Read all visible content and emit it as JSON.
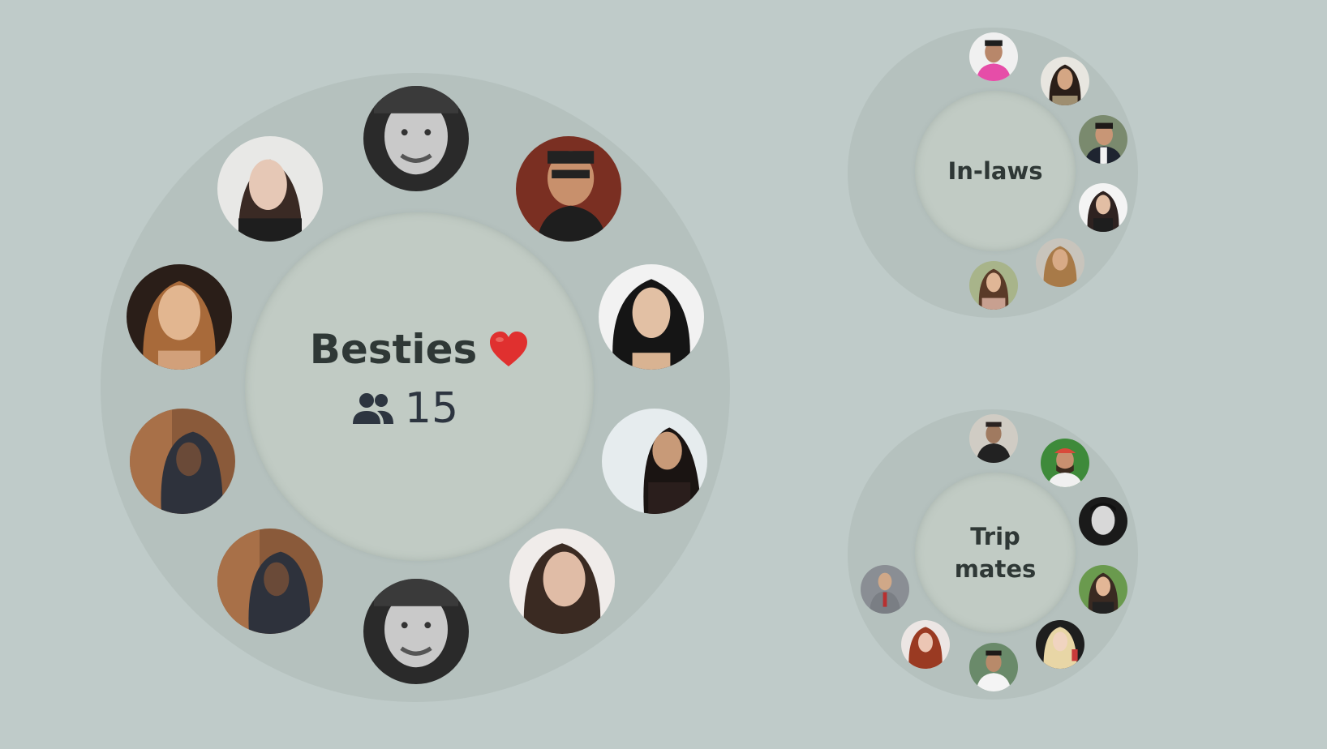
{
  "groups": {
    "besties": {
      "name": "Besties",
      "member_count": "15"
    },
    "inlaws": {
      "name": "In-laws"
    },
    "trip": {
      "name_line1": "Trip",
      "name_line2": "mates"
    }
  },
  "icons": {
    "member_count": "people-icon",
    "besties_emoji": "heart-icon"
  },
  "colors": {
    "background": "#bfcbc9",
    "ring": "#b5c1be",
    "hub": "#c1cbc4",
    "heart": "#e0302f"
  }
}
